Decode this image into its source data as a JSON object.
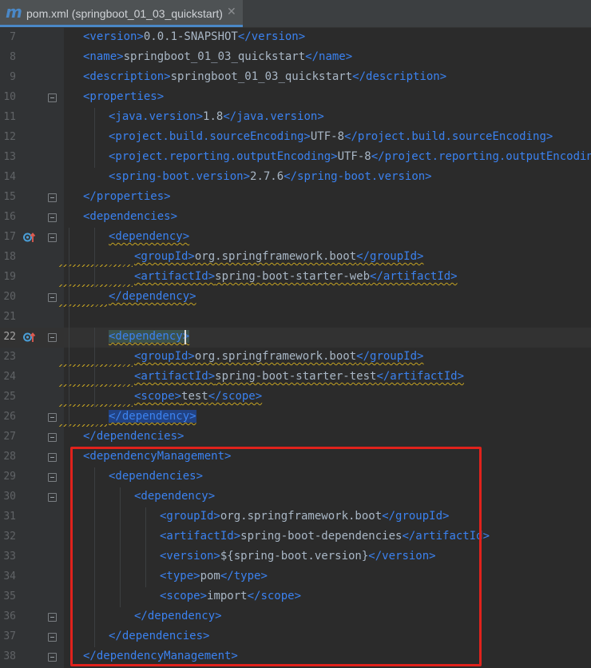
{
  "tab": {
    "logo": "m",
    "title": "pom.xml (springboot_01_03_quickstart)",
    "close": "✕"
  },
  "accent": "#4a88c7",
  "highlight_color": "#e0221c",
  "lines": [
    {
      "num": "7",
      "tokens": [
        [
          "t",
          "<version>"
        ],
        [
          "x",
          "0.0.1-SNAPSHOT"
        ],
        [
          "t",
          "</version>"
        ]
      ]
    },
    {
      "num": "8",
      "tokens": [
        [
          "t",
          "<name>"
        ],
        [
          "x",
          "springboot_01_03_quickstart"
        ],
        [
          "t",
          "</name>"
        ]
      ]
    },
    {
      "num": "9",
      "tokens": [
        [
          "t",
          "<description>"
        ],
        [
          "x",
          "springboot_01_03_quickstart"
        ],
        [
          "t",
          "</description>"
        ]
      ]
    },
    {
      "num": "10",
      "tokens": [
        [
          "t",
          "<properties>"
        ]
      ]
    },
    {
      "num": "11",
      "tokens": [
        [
          "t",
          "<java.version>"
        ],
        [
          "x",
          "1.8"
        ],
        [
          "t",
          "</java.version>"
        ]
      ]
    },
    {
      "num": "12",
      "tokens": [
        [
          "t",
          "<project.build.sourceEncoding>"
        ],
        [
          "x",
          "UTF-8"
        ],
        [
          "t",
          "</project.build.sourceEncoding>"
        ]
      ]
    },
    {
      "num": "13",
      "tokens": [
        [
          "t",
          "<project.reporting.outputEncoding>"
        ],
        [
          "x",
          "UTF-8"
        ],
        [
          "t",
          "</project.reporting.outputEncoding>"
        ]
      ]
    },
    {
      "num": "14",
      "tokens": [
        [
          "t",
          "<spring-boot.version>"
        ],
        [
          "x",
          "2.7.6"
        ],
        [
          "t",
          "</spring-boot.version>"
        ]
      ]
    },
    {
      "num": "15",
      "tokens": [
        [
          "t",
          "</properties>"
        ]
      ]
    },
    {
      "num": "16",
      "tokens": [
        [
          "t",
          "<dependencies>"
        ]
      ]
    },
    {
      "num": "17",
      "tokens": [
        [
          "t",
          "<dependency>"
        ]
      ]
    },
    {
      "num": "18",
      "tokens": [
        [
          "t",
          "<groupId>"
        ],
        [
          "x",
          "org.springframework.boot"
        ],
        [
          "t",
          "</groupId>"
        ]
      ]
    },
    {
      "num": "19",
      "tokens": [
        [
          "t",
          "<artifactId>"
        ],
        [
          "x",
          "spring-boot-starter-web"
        ],
        [
          "t",
          "</artifactId>"
        ]
      ]
    },
    {
      "num": "20",
      "tokens": [
        [
          "t",
          "</dependency>"
        ]
      ]
    },
    {
      "num": "21",
      "tokens": []
    },
    {
      "num": "22",
      "tokens": [
        [
          "t",
          "<dependency>"
        ]
      ]
    },
    {
      "num": "23",
      "tokens": [
        [
          "t",
          "<groupId>"
        ],
        [
          "x",
          "org.springframework.boot"
        ],
        [
          "t",
          "</groupId>"
        ]
      ]
    },
    {
      "num": "24",
      "tokens": [
        [
          "t",
          "<artifactId>"
        ],
        [
          "x",
          "spring-boot-starter-test"
        ],
        [
          "t",
          "</artifactId>"
        ]
      ]
    },
    {
      "num": "25",
      "tokens": [
        [
          "t",
          "<scope>"
        ],
        [
          "x",
          "test"
        ],
        [
          "t",
          "</scope>"
        ]
      ]
    },
    {
      "num": "26",
      "tokens": [
        [
          "t",
          "</dependency>"
        ]
      ]
    },
    {
      "num": "27",
      "tokens": [
        [
          "t",
          "</dependencies>"
        ]
      ]
    },
    {
      "num": "28",
      "tokens": [
        [
          "t",
          "<dependencyManagement>"
        ]
      ]
    },
    {
      "num": "29",
      "tokens": [
        [
          "t",
          "<dependencies>"
        ]
      ]
    },
    {
      "num": "30",
      "tokens": [
        [
          "t",
          "<dependency>"
        ]
      ]
    },
    {
      "num": "31",
      "tokens": [
        [
          "t",
          "<groupId>"
        ],
        [
          "x",
          "org.springframework.boot"
        ],
        [
          "t",
          "</groupId>"
        ]
      ]
    },
    {
      "num": "32",
      "tokens": [
        [
          "t",
          "<artifactId>"
        ],
        [
          "x",
          "spring-boot-dependencies"
        ],
        [
          "t",
          "</artifactId>"
        ]
      ]
    },
    {
      "num": "33",
      "tokens": [
        [
          "t",
          "<version>"
        ],
        [
          "x",
          "${spring-boot.version}"
        ],
        [
          "t",
          "</version>"
        ]
      ]
    },
    {
      "num": "34",
      "tokens": [
        [
          "t",
          "<type>"
        ],
        [
          "x",
          "pom"
        ],
        [
          "t",
          "</type>"
        ]
      ]
    },
    {
      "num": "35",
      "tokens": [
        [
          "t",
          "<scope>"
        ],
        [
          "x",
          "import"
        ],
        [
          "t",
          "</scope>"
        ]
      ]
    },
    {
      "num": "36",
      "tokens": [
        [
          "t",
          "</dependency>"
        ]
      ]
    },
    {
      "num": "37",
      "tokens": [
        [
          "t",
          "</dependencies>"
        ]
      ]
    },
    {
      "num": "38",
      "tokens": [
        [
          "t",
          "</dependencyManagement>"
        ]
      ]
    }
  ]
}
